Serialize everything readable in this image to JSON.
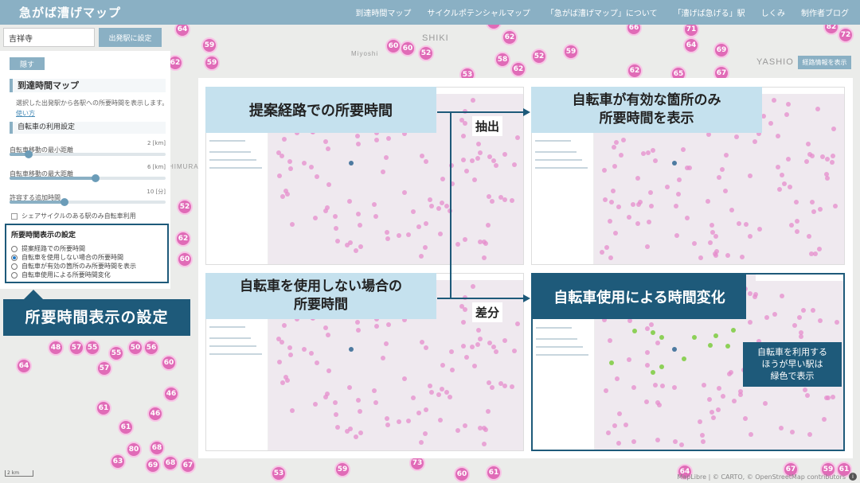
{
  "header": {
    "title": "急がば漕げマップ",
    "nav": [
      "到達時間マップ",
      "サイクルポテンシャルマップ",
      "「急がば漕げマップ」について",
      "「漕げば急げる」駅",
      "しくみ",
      "制作者ブログ"
    ]
  },
  "search": {
    "value": "吉祥寺",
    "button": "出発駅に設定"
  },
  "panel": {
    "hide_button": "隠す",
    "title": "到達時間マップ",
    "description": "選択した出発駅から各駅への所要時間を表示します。",
    "usage_link": "使い方",
    "bike_settings_title": "自転車の利用設定",
    "sliders": [
      {
        "label": "自転車移動の最小距離",
        "value": "2 [km]",
        "level": 0.12
      },
      {
        "label": "自転車移動の最大距離",
        "value": "6 [km]",
        "level": 0.55
      },
      {
        "label": "許容する追加時間",
        "value": "10 [分]",
        "level": 0.35
      }
    ],
    "share_cycle_label": "シェアサイクルのある駅のみ自転車利用"
  },
  "display_settings": {
    "title": "所要時間表示の設定",
    "options": [
      {
        "label": "提案経路での所要時間",
        "selected": false
      },
      {
        "label": "自転車を使用しない場合の所要時間",
        "selected": true
      },
      {
        "label": "自転車が有効の箇所のみ所要時間を表示",
        "selected": false
      },
      {
        "label": "自転車使用による所要時間変化",
        "selected": false
      }
    ]
  },
  "callout_display": "所要時間表示の設定",
  "route_info_button": "経路情報を表示",
  "map_labels": {
    "shiki": "SHIKI",
    "miyoshi": "Miyoshi",
    "yashio": "YASHIO",
    "himurayama": "HIMURAYAMA"
  },
  "overlay": {
    "captions": {
      "top_left": "提案経路での所要時間",
      "top_right_1": "自転車が有効な箇所のみ",
      "top_right_2": "所要時間を表示",
      "bottom_left_1": "自転車を使用しない場合の",
      "bottom_left_2": "所要時間",
      "bottom_right": "自転車使用による時間変化"
    },
    "extract_label": "抽出",
    "diff_label": "差分",
    "green_note": [
      "自転車を利用する",
      "ほうが早い駅は",
      "緑色で表示"
    ]
  },
  "scale_label": "2 km",
  "attribution": "MapLibre | © CARTO, © OpenStreetMap contributors",
  "colors": {
    "accent": "#8ab0c4",
    "dark": "#1e5a7a",
    "station": "#e06bb7",
    "faster": "#87cf4f"
  }
}
